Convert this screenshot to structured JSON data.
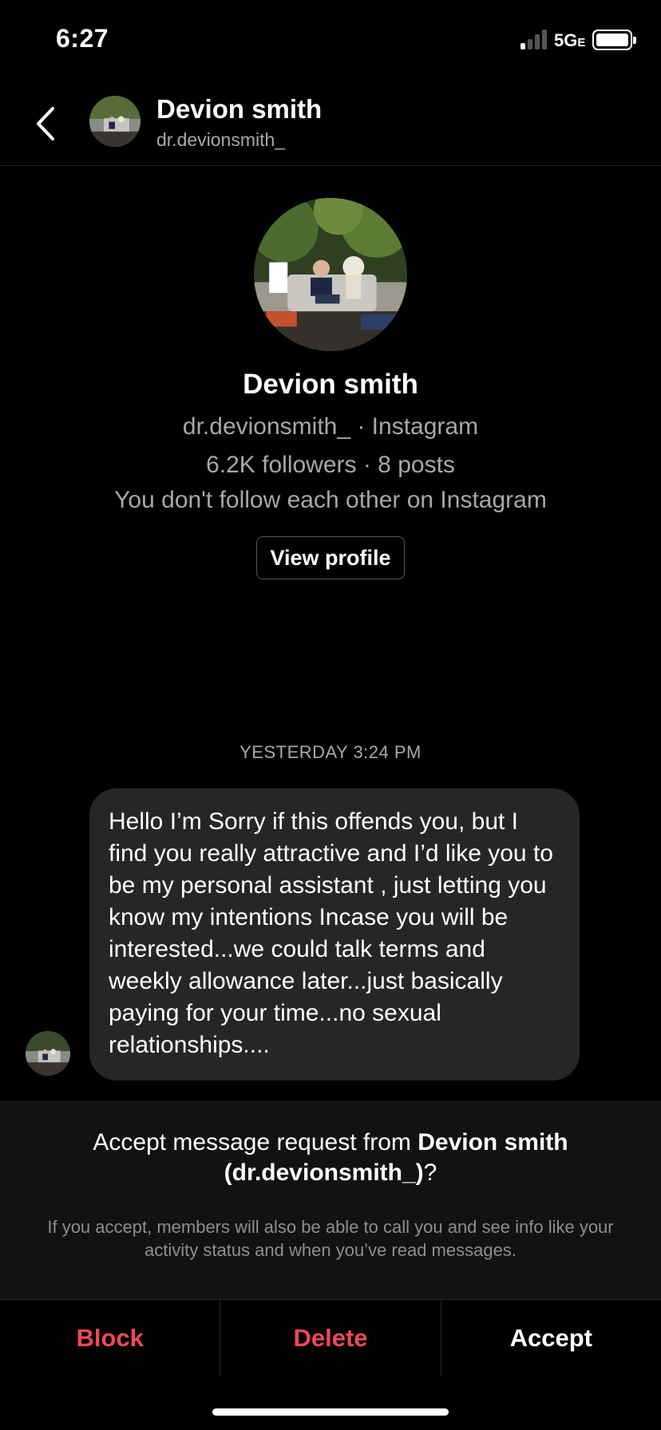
{
  "status_bar": {
    "time": "6:27",
    "network": "5G",
    "network_suffix": "E",
    "signal_icon": "signal-bars-icon",
    "battery_icon": "battery-full-icon"
  },
  "header": {
    "name": "Devion smith",
    "handle": "dr.devionsmith_",
    "back_icon": "chevron-left-icon"
  },
  "profile": {
    "name": "Devion smith",
    "line1": "dr.devionsmith_ · Instagram",
    "line2": "6.2K followers · 8 posts",
    "line3": "You don't follow each other on Instagram",
    "view_profile_label": "View profile"
  },
  "conversation": {
    "timestamp": "YESTERDAY 3:24 PM",
    "message": "Hello  I’m Sorry if this offends you, but I find you really attractive and I’d like you to be my personal assistant , just letting you know my intentions Incase you will be interested...we could talk terms and weekly allowance later...just basically paying for your time...no sexual relationships...."
  },
  "request": {
    "prefix": "Accept message request from ",
    "name": "Devion smith",
    "handle_bold": "(dr.devionsmith_)",
    "suffix": "?",
    "note": "If you accept, members will also be able to call you and see info like your activity status and when you’ve read messages."
  },
  "actions": {
    "block": "Block",
    "delete": "Delete",
    "accept": "Accept"
  },
  "colors": {
    "background": "#000000",
    "bubble": "#262626",
    "danger": "#ed4956",
    "secondary_text": "#a8a8a8"
  }
}
